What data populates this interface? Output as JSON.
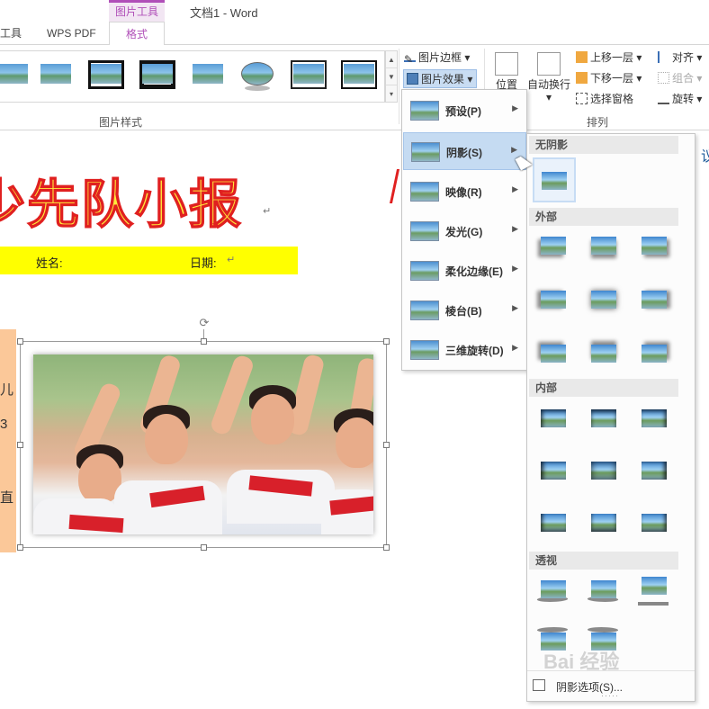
{
  "window": {
    "context_tab_group": "图片工具",
    "doc_title": "文档1 - Word"
  },
  "tabs": {
    "tools": "工具",
    "wps_pdf": "WPS PDF",
    "format": "格式"
  },
  "ribbon": {
    "styles_group_label": "图片样式",
    "picture_border": "图片边框",
    "picture_effects": "图片效果",
    "position": "位置",
    "wrap_text": "自动换行",
    "bring_forward": "上移一层",
    "send_backward": "下移一层",
    "selection_pane": "选择窗格",
    "align": "对齐",
    "group": "组合",
    "rotate": "旋转",
    "arrange_group_label": "排列"
  },
  "document": {
    "heading": "少先队小报",
    "name_label": "姓名:",
    "date_label": "日期:",
    "side_chars": [
      "儿",
      "3",
      "直"
    ],
    "right_fragment": "议"
  },
  "effects_menu": {
    "items": [
      {
        "label": "预设(P)",
        "icon": "preset-icon"
      },
      {
        "label": "阴影(S)",
        "icon": "shadow-icon"
      },
      {
        "label": "映像(R)",
        "icon": "reflection-icon"
      },
      {
        "label": "发光(G)",
        "icon": "glow-icon"
      },
      {
        "label": "柔化边缘(E)",
        "icon": "soft-edges-icon"
      },
      {
        "label": "棱台(B)",
        "icon": "bevel-icon"
      },
      {
        "label": "三维旋转(D)",
        "icon": "3d-rotation-icon"
      }
    ],
    "active_index": 1
  },
  "shadow_gallery": {
    "sections": {
      "none": "无阴影",
      "outer": "外部",
      "inner": "内部",
      "perspective": "透视"
    },
    "options_label": "阴影选项(S)...",
    "watermark": "Bai 经验"
  },
  "colors": {
    "accent_purple": "#b04fb8",
    "menu_highlight": "#c5dbf2",
    "heading_fill": "#ffec3c",
    "heading_stroke": "#e02020",
    "name_bar": "#ffff00",
    "side_box": "#fbc899"
  }
}
